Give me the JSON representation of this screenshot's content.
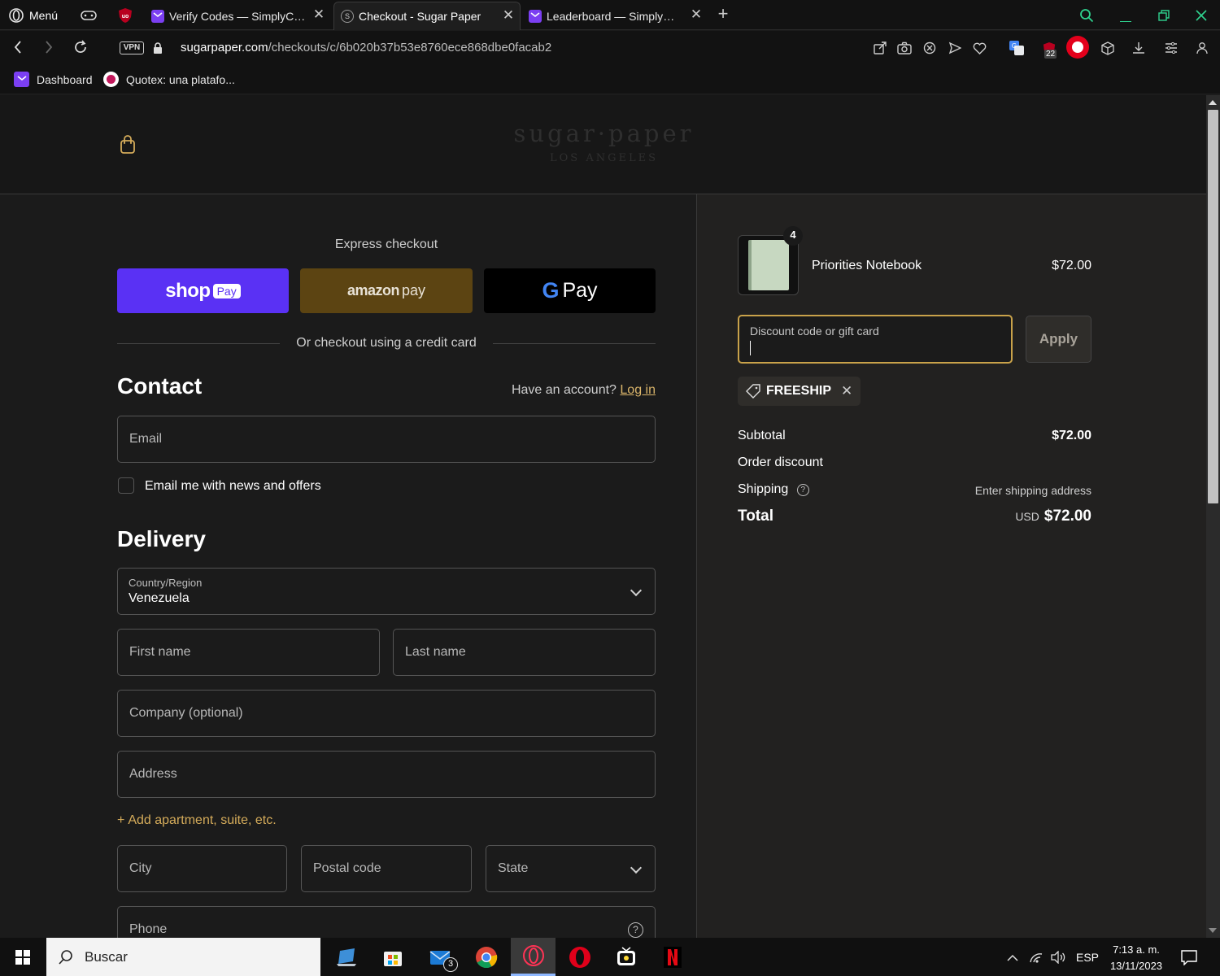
{
  "browser": {
    "menu_label": "Menú",
    "tabs": [
      {
        "title": "Verify Codes — SimplyCodes",
        "active": false
      },
      {
        "title": "Checkout - Sugar Paper",
        "active": true
      },
      {
        "title": "Leaderboard — SimplyCodes",
        "active": false
      }
    ],
    "vpn_badge": "VPN",
    "url_domain": "sugarpaper.com",
    "url_path": "/checkouts/c/6b020b37b53e8760ece868dbe0facab2",
    "extension_badge": "22",
    "bookmarks": [
      {
        "label": "Dashboard",
        "icon": "simplycodes-icon"
      },
      {
        "label": "Quotex: una platafo...",
        "icon": "quotex-icon"
      }
    ]
  },
  "store": {
    "logo_main": "sugar·paper",
    "logo_sub": "LOS ANGELES"
  },
  "checkout": {
    "express_title": "Express checkout",
    "shop_pay": {
      "word": "shop",
      "badge": "Pay"
    },
    "amazon_pay": {
      "word": "amazon",
      "suffix": "pay"
    },
    "google_pay": {
      "g": "G",
      "word": "Pay"
    },
    "divider_text": "Or checkout using a credit card",
    "contact": {
      "heading": "Contact",
      "account_prompt": "Have an account?",
      "login_link": "Log in",
      "email_placeholder": "Email",
      "newsletter_label": "Email me with news and offers"
    },
    "delivery": {
      "heading": "Delivery",
      "country_label": "Country/Region",
      "country_value": "Venezuela",
      "first_name": "First name",
      "last_name": "Last name",
      "company": "Company (optional)",
      "address": "Address",
      "add_apartment": "Add apartment, suite, etc.",
      "city": "City",
      "postal_code": "Postal code",
      "state": "State",
      "phone": "Phone"
    }
  },
  "summary": {
    "item": {
      "name": "Priorities Notebook",
      "price": "$72.00",
      "quantity": "4"
    },
    "discount_placeholder": "Discount code or gift card",
    "apply_label": "Apply",
    "applied_code": "FREESHIP",
    "subtotal_label": "Subtotal",
    "subtotal_value": "$72.00",
    "order_discount_label": "Order discount",
    "shipping_label": "Shipping",
    "shipping_value": "Enter shipping address",
    "total_label": "Total",
    "total_currency": "USD",
    "total_value": "$72.00"
  },
  "taskbar": {
    "search_label": "Buscar",
    "mail_badge": "3",
    "language": "ESP",
    "time": "7:13 a. m.",
    "date": "13/11/2023"
  },
  "colors": {
    "shop_pay": "#5a31f4",
    "amazon_pay": "#5c4412",
    "google_pay": "#000000",
    "accent_gold": "#c9a24a",
    "link": "#d9b46a"
  }
}
